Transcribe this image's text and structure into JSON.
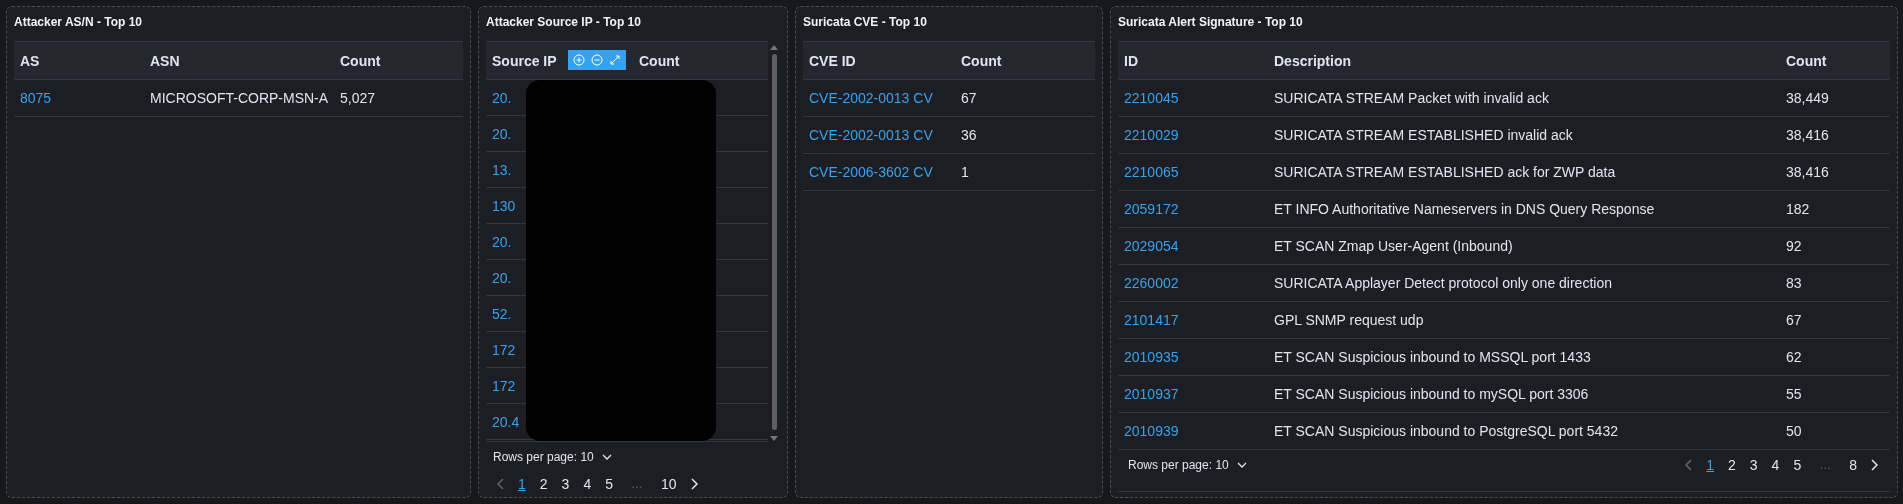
{
  "panels": [
    {
      "title": "Attacker AS/N - Top 10",
      "columns": [
        {
          "label": "AS",
          "kind": "link"
        },
        {
          "label": "ASN",
          "kind": "text"
        },
        {
          "label": "Count",
          "kind": "text"
        }
      ],
      "rows": [
        [
          "8075",
          "MICROSOFT-CORP-MSN-A",
          "5,027"
        ]
      ]
    },
    {
      "title": "Attacker Source IP - Top 10",
      "scrollable": true,
      "redacted": true,
      "zoom_toolbar": true,
      "columns": [
        {
          "label": "Source IP",
          "kind": "link"
        },
        {
          "label": "Count",
          "kind": "text"
        }
      ],
      "rows": [
        [
          "20."
        ],
        [
          "20."
        ],
        [
          "13."
        ],
        [
          "130"
        ],
        [
          "20."
        ],
        [
          "20."
        ],
        [
          "52."
        ],
        [
          "172"
        ],
        [
          "172"
        ],
        [
          "20.4"
        ]
      ],
      "pagination": {
        "rows_per_page": "Rows per page: 10",
        "pages": [
          {
            "label": "1",
            "selected": true
          },
          {
            "label": "2",
            "selected": false
          },
          {
            "label": "3",
            "selected": false
          },
          {
            "label": "4",
            "selected": false
          },
          {
            "label": "5",
            "selected": false
          },
          {
            "label": "…",
            "kind": "gap"
          },
          {
            "label": "10",
            "selected": false
          }
        ]
      }
    },
    {
      "title": "Suricata CVE - Top 10",
      "columns": [
        {
          "label": "CVE ID",
          "kind": "link"
        },
        {
          "label": "Count",
          "kind": "text"
        }
      ],
      "rows": [
        [
          "CVE-2002-0013 CV",
          "67"
        ],
        [
          "CVE-2002-0013 CV",
          "36"
        ],
        [
          "CVE-2006-3602 CV",
          "1"
        ]
      ]
    },
    {
      "title": "Suricata Alert Signature - Top 10",
      "columns": [
        {
          "label": "ID",
          "kind": "link"
        },
        {
          "label": "Description",
          "kind": "text"
        },
        {
          "label": "Count",
          "kind": "text"
        }
      ],
      "rows": [
        [
          "2210045",
          "SURICATA STREAM Packet with invalid ack",
          "38,449"
        ],
        [
          "2210029",
          "SURICATA STREAM ESTABLISHED invalid ack",
          "38,416"
        ],
        [
          "2210065",
          "SURICATA STREAM ESTABLISHED ack for ZWP data",
          "38,416"
        ],
        [
          "2059172",
          "ET INFO Authoritative Nameservers in DNS Query Response",
          "182"
        ],
        [
          "2029054",
          "ET SCAN Zmap User-Agent (Inbound)",
          "92"
        ],
        [
          "2260002",
          "SURICATA Applayer Detect protocol only one direction",
          "83"
        ],
        [
          "2101417",
          "GPL SNMP request udp",
          "67"
        ],
        [
          "2010935",
          "ET SCAN Suspicious inbound to MSSQL port 1433",
          "62"
        ],
        [
          "2010937",
          "ET SCAN Suspicious inbound to mySQL port 3306",
          "55"
        ],
        [
          "2010939",
          "ET SCAN Suspicious inbound to PostgreSQL port 5432",
          "50"
        ]
      ],
      "pagination": {
        "rows_per_page": "Rows per page: 10",
        "pages": [
          {
            "label": "1",
            "selected": true
          },
          {
            "label": "2",
            "selected": false
          },
          {
            "label": "3",
            "selected": false
          },
          {
            "label": "4",
            "selected": false
          },
          {
            "label": "5",
            "selected": false
          },
          {
            "label": "…",
            "kind": "gap"
          },
          {
            "label": "8",
            "selected": false
          }
        ]
      }
    }
  ]
}
